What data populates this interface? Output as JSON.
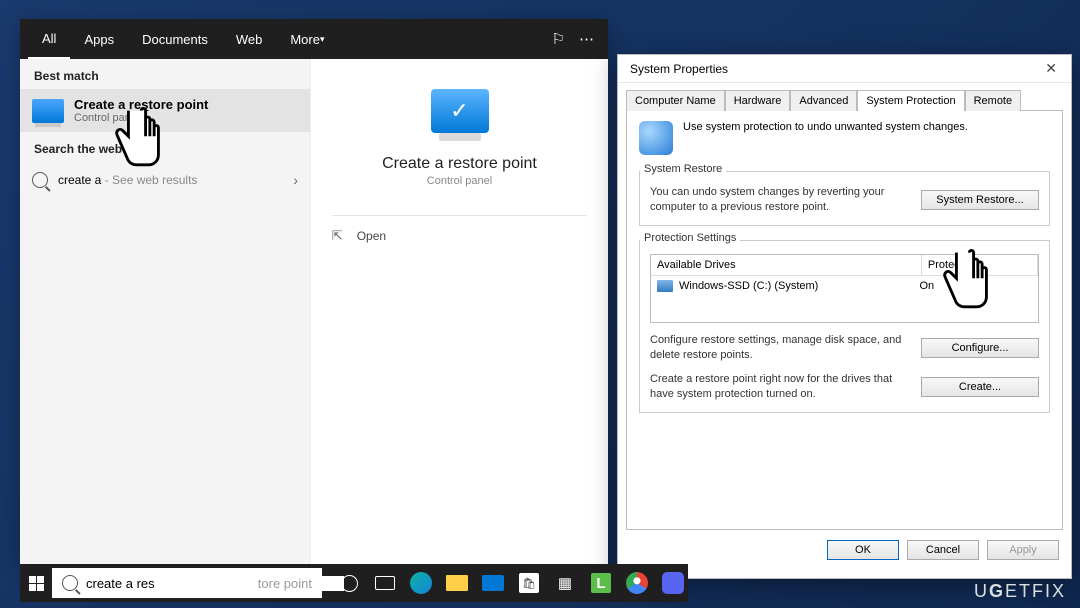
{
  "tabs": {
    "all": "All",
    "apps": "Apps",
    "documents": "Documents",
    "web": "Web",
    "more": "More"
  },
  "sections": {
    "best_match": "Best match",
    "search_web": "Search the web"
  },
  "best_match": {
    "title": "Create a re",
    "title_u": "s",
    "title_rest": "tore point",
    "sub": "Control panel"
  },
  "web_result": {
    "prefix": "create a ",
    "suffix": "",
    "hint": "- See web results"
  },
  "right_panel": {
    "title": "Create a restore point",
    "sub": "Control panel",
    "open": "Open"
  },
  "sysprops": {
    "title": "System Properties",
    "tabs": [
      "Computer Name",
      "Hardware",
      "Advanced",
      "System Protection",
      "Remote"
    ],
    "intro": "Use system protection to undo unwanted system changes.",
    "restore_group": "System Restore",
    "restore_desc": "You can undo system changes by reverting your computer to a previous restore point.",
    "restore_btn": "System Restore...",
    "protection_group": "Protection Settings",
    "col_drives": "Available Drives",
    "col_protection": "Protection",
    "drive_name": "Windows-SSD (C:) (System)",
    "drive_status": "On",
    "configure_desc": "Configure restore settings, manage disk space, and delete restore points.",
    "configure_btn": "Configure...",
    "create_desc": "Create a restore point right now for the drives that have system protection turned on.",
    "create_btn": "Create...",
    "ok": "OK",
    "cancel": "Cancel",
    "apply": "Apply"
  },
  "taskbar": {
    "search_value": "create a res",
    "search_rest": "tore point"
  },
  "watermark": "UGETFIX"
}
